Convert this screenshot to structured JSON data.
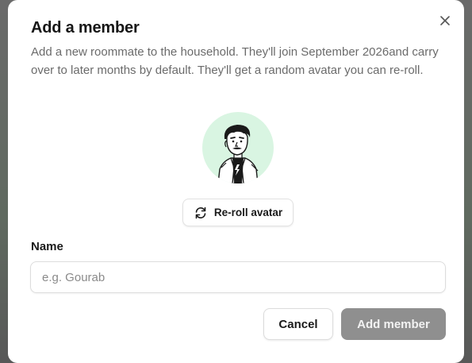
{
  "dialog": {
    "title": "Add a member",
    "description": "Add a new roommate to the household. They'll join September 2026and carry over to later months by default. They'll get a random avatar you can re-roll.",
    "close_icon": "close-icon",
    "avatar": {
      "icon": "cartoon-person-avatar",
      "background_color": "#d9f5e2"
    },
    "reroll_button": {
      "label": "Re-roll avatar",
      "icon": "refresh-icon"
    },
    "name_field": {
      "label": "Name",
      "placeholder": "e.g. Gourab",
      "value": ""
    },
    "actions": {
      "cancel_label": "Cancel",
      "submit_label": "Add member",
      "submit_disabled": true
    }
  },
  "colors": {
    "dialog_background": "#ffffff",
    "title_text": "#161616",
    "muted_text": "#6b6b6b",
    "submit_disabled_bg": "#8f8f8f"
  }
}
